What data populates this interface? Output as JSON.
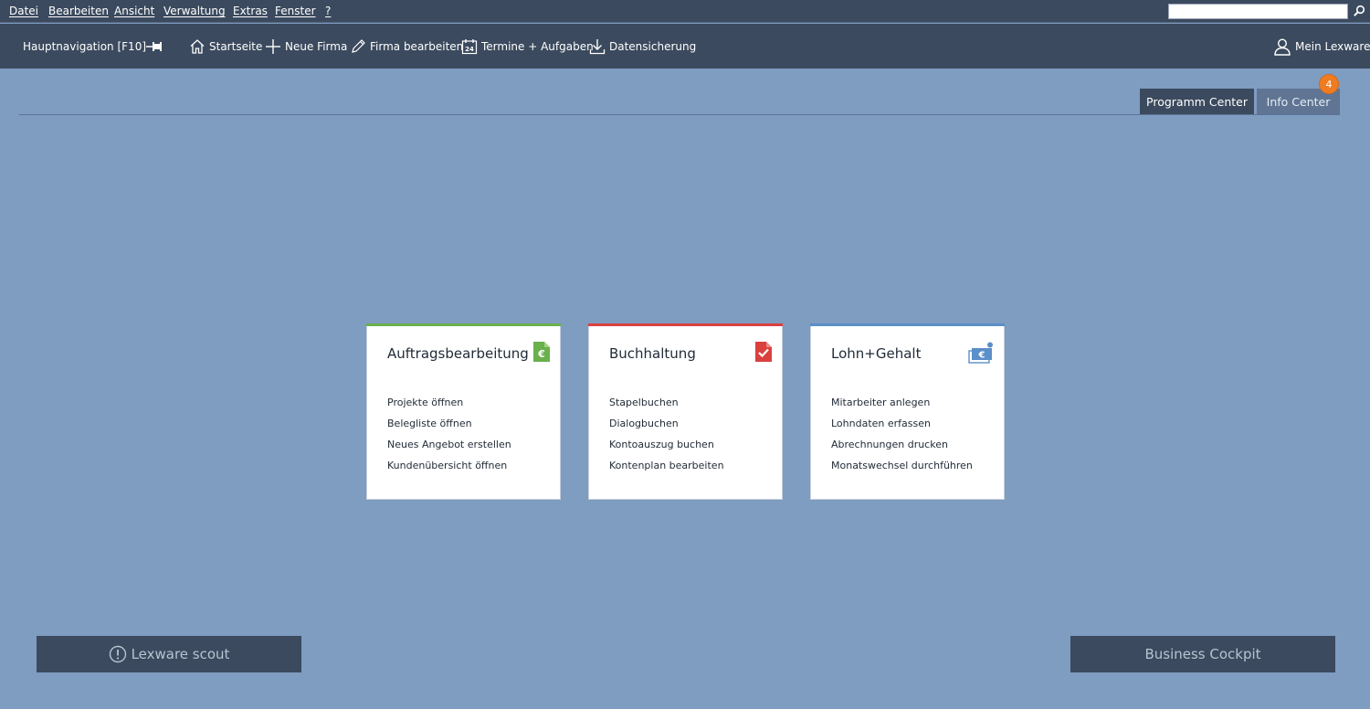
{
  "menu": {
    "items": [
      "Datei",
      "Bearbeiten",
      "Ansicht",
      "Verwaltung",
      "Extras",
      "Fenster",
      "?"
    ]
  },
  "search": {
    "value": ""
  },
  "toolbar": {
    "nav_label": "Hauptnavigation [F10]",
    "startseite": "Startseite",
    "neue_firma": "Neue Firma",
    "firma_bearbeiten": "Firma bearbeiten",
    "termine": "Termine + Aufgaben",
    "datensicherung": "Datensicherung",
    "account": "Mein Lexware",
    "calendar_day": "24"
  },
  "center_tabs": {
    "programm": "Programm Center",
    "info": "Info Center",
    "info_badge": "4"
  },
  "cards": [
    {
      "title": "Auftragsbearbeitung",
      "accent": "#6ab04c",
      "icon": "invoice-euro-icon",
      "items": [
        "Projekte öffnen",
        "Belegliste öffnen",
        "Neues Angebot erstellen",
        "Kundenübersicht öffnen"
      ]
    },
    {
      "title": "Buchhaltung",
      "accent": "#d9413f",
      "icon": "checked-document-icon",
      "items": [
        "Stapelbuchen",
        "Dialogbuchen",
        "Kontoauszug buchen",
        "Kontenplan bearbeiten"
      ]
    },
    {
      "title": "Lohn+Gehalt",
      "accent": "#5b8fc9",
      "icon": "money-euro-icon",
      "items": [
        "Mitarbeiter anlegen",
        "Lohndaten erfassen",
        "Abrechnungen drucken",
        "Monatswechsel durchführen"
      ]
    }
  ],
  "bottom": {
    "scout": "Lexware scout",
    "cockpit": "Business Cockpit"
  },
  "colors": {
    "background": "#7f9cc1",
    "bar": "#3b4a5e",
    "badge": "#f07c22"
  }
}
